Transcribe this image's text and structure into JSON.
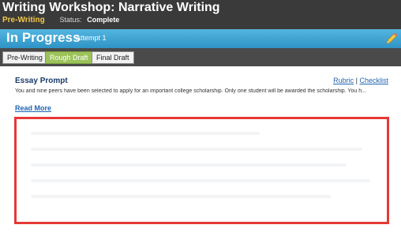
{
  "header": {
    "title": "Writing Workshop: Narrative Writing",
    "stage": "Pre-Writing",
    "status_label": "Status:",
    "status_value": "Complete"
  },
  "progress": {
    "title": "In Progress",
    "attempt": "Attempt 1",
    "edit_icon": "pencil-icon",
    "accent_color": "#3aa3d6"
  },
  "tabs": [
    {
      "label": "Pre-Writing",
      "active": false
    },
    {
      "label": "Rough Draft",
      "active": true
    },
    {
      "label": "Final Draft",
      "active": false
    }
  ],
  "essay": {
    "heading": "Essay Prompt",
    "rubric_link": "Rubric",
    "separator": "|",
    "checklist_link": "Checklist",
    "prompt_text": "You and nine peers have been selected to apply for an important college scholarship. Only one student will be awarded the scholarship. You h...",
    "read_more": "Read More"
  },
  "editor": {
    "highlight_color": "#e53935"
  }
}
